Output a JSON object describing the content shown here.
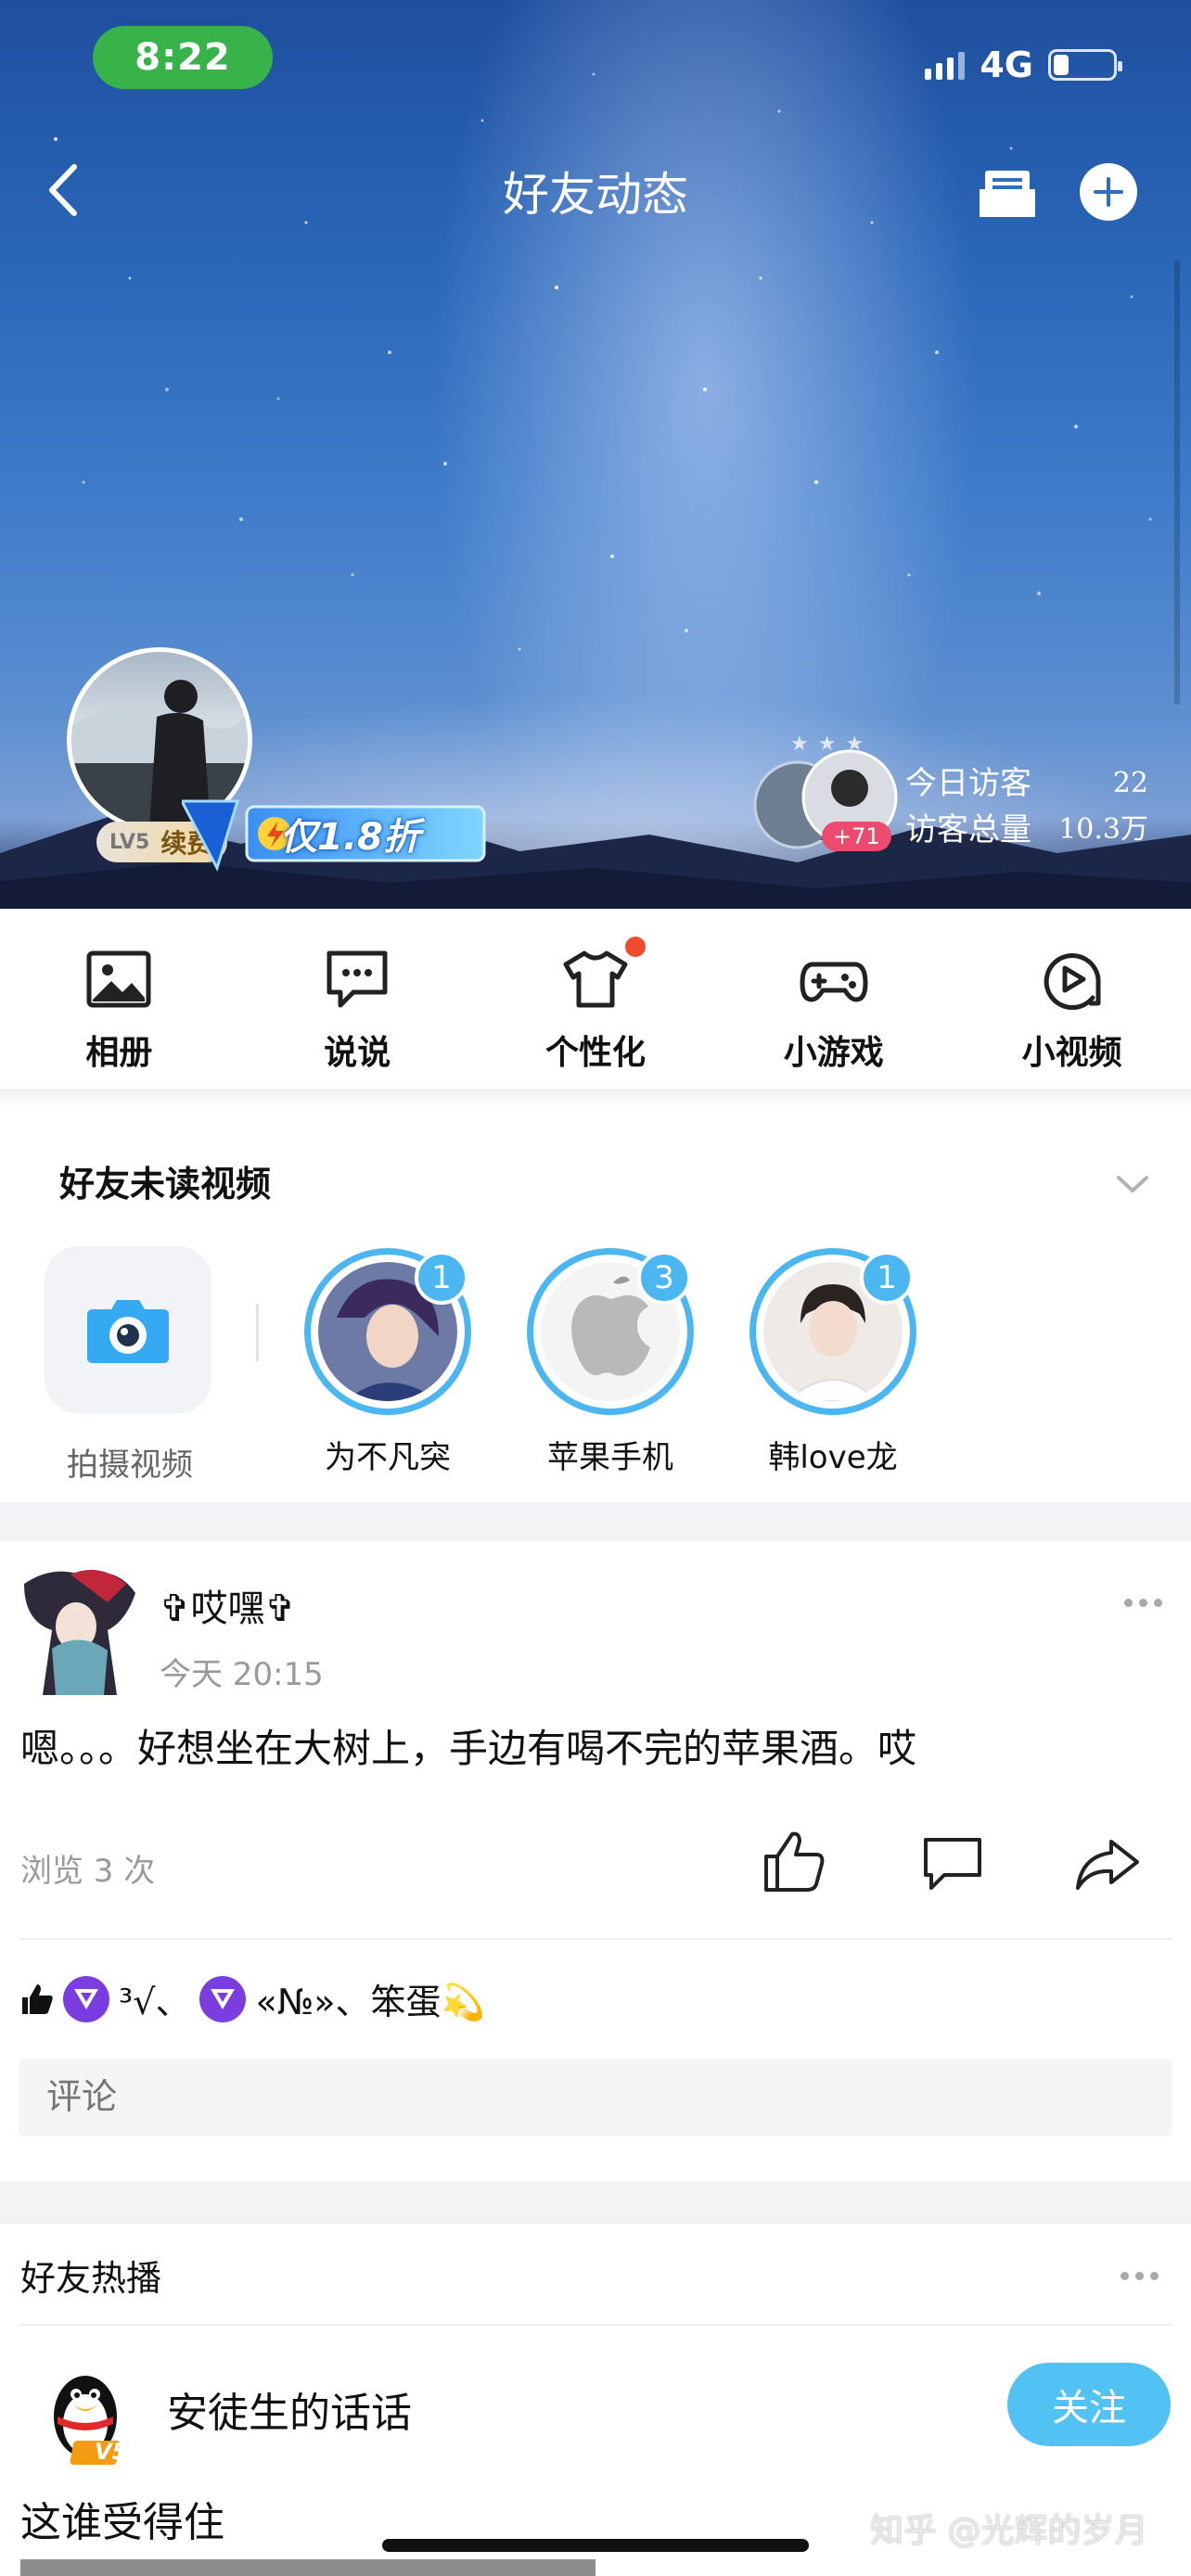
{
  "status_bar": {
    "time": "8:22",
    "network": "4G"
  },
  "nav": {
    "title": "好友动态"
  },
  "profile": {
    "level_badge": "LV5",
    "renew_label": "续费",
    "vip_promo": "仅1.8折",
    "visitor_more": "+71",
    "today_visitors_label": "今日访客",
    "today_visitors_value": "22",
    "total_visitors_label": "访客总量",
    "total_visitors_value": "10.3万"
  },
  "quick_menu": [
    {
      "label": "相册",
      "icon": "photo-album-icon"
    },
    {
      "label": "说说",
      "icon": "chat-bubble-icon"
    },
    {
      "label": "个性化",
      "icon": "tshirt-icon",
      "has_dot": true
    },
    {
      "label": "小游戏",
      "icon": "gamepad-icon"
    },
    {
      "label": "小视频",
      "icon": "play-circle-icon"
    }
  ],
  "friend_videos": {
    "title": "好友未读视频",
    "shoot_label": "拍摄视频",
    "items": [
      {
        "name": "为不凡突",
        "count": "1"
      },
      {
        "name": "苹果手机",
        "count": "3"
      },
      {
        "name": "韩love龙",
        "count": "1"
      }
    ]
  },
  "post": {
    "author": "✞哎嘿✞",
    "time": "今天 20:15",
    "text": "嗯。。。好想坐在大树上，手边有喝不完的苹果酒。哎",
    "views": "浏览 3 次",
    "likes_seg1": "³√、",
    "likes_seg2": "«№»、笨蛋💫",
    "comment_placeholder": "评论"
  },
  "hot": {
    "title": "好友热播",
    "author": "安徒生的话话",
    "author_level": "V5",
    "follow_label": "关注",
    "text": "这谁受得住"
  },
  "watermark": "知乎 @光辉的岁月",
  "colors": {
    "accent_blue": "#4bb6f0",
    "follow_blue": "#52c1f4",
    "status_green": "#37b34a",
    "notify_red": "#f24a2e",
    "vip_purple": "#7a3de0"
  }
}
